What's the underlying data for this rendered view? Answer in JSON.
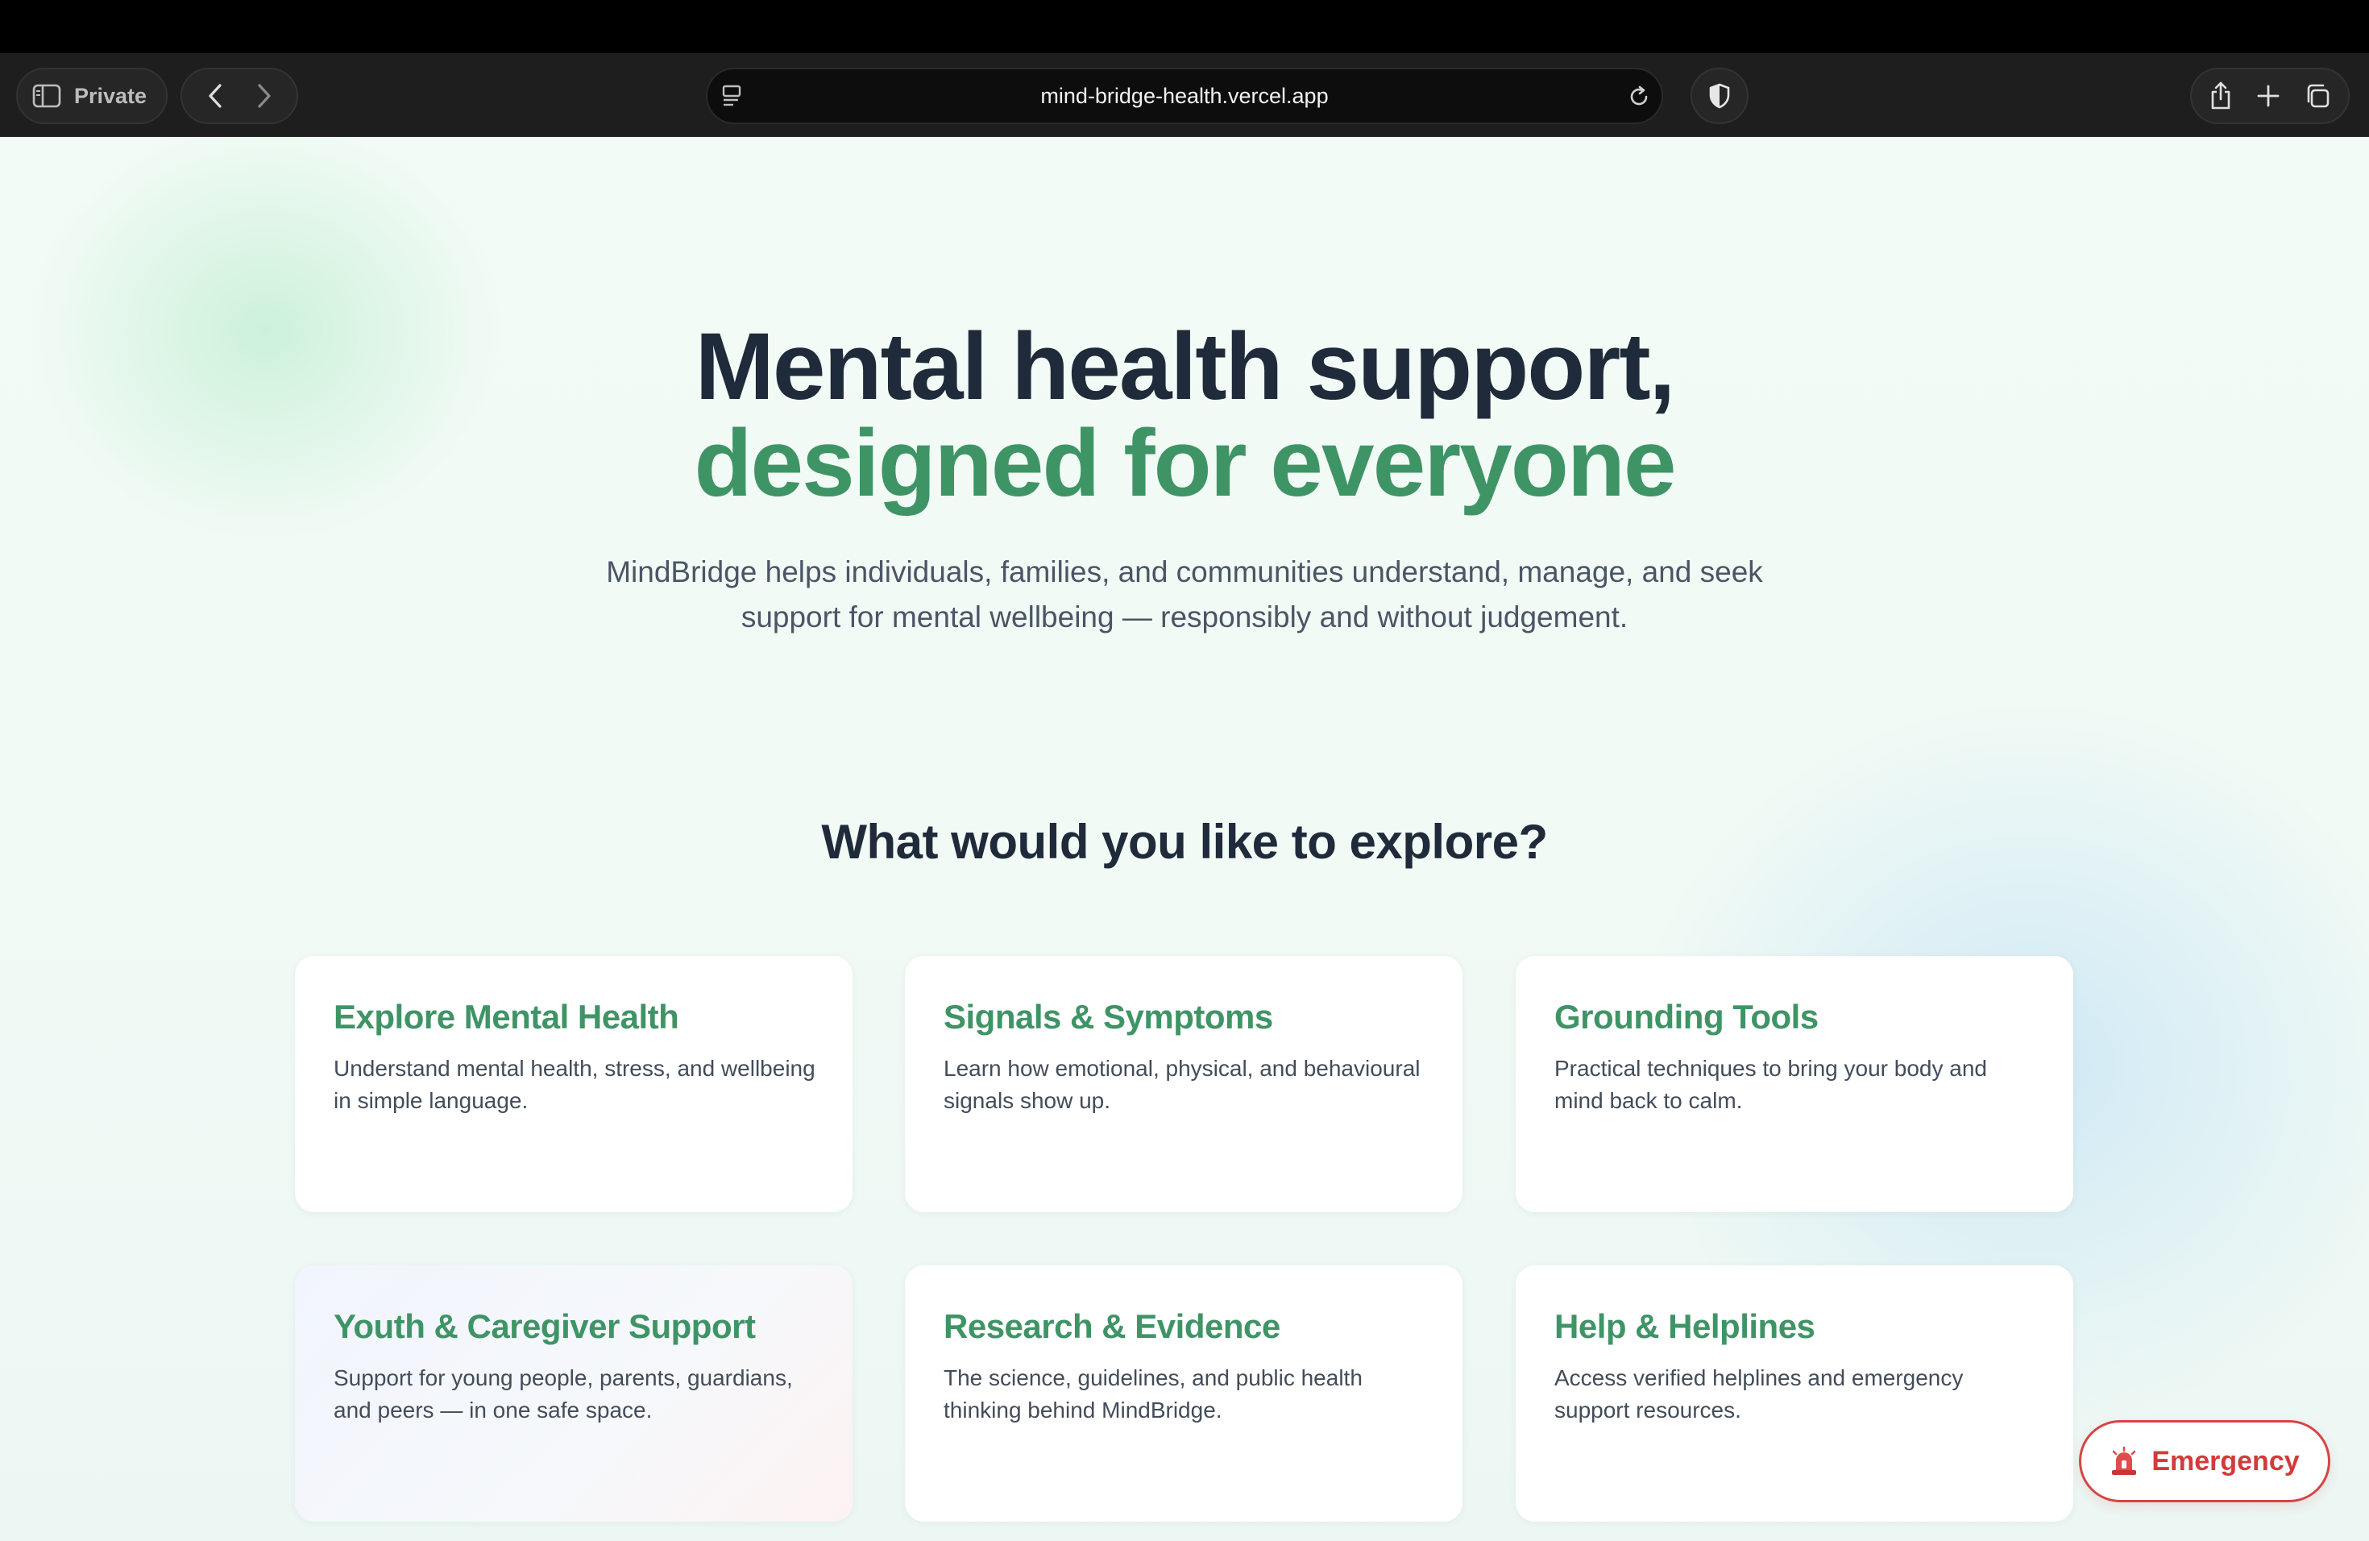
{
  "browser": {
    "private_label": "Private",
    "url": "mind-bridge-health.vercel.app"
  },
  "hero": {
    "line1": "Mental health support,",
    "line2": "designed for everyone",
    "subtitle": "MindBridge helps individuals, families, and communities understand, manage, and seek support for mental wellbeing — responsibly and without judgement."
  },
  "explore": {
    "heading": "What would you like to explore?",
    "cards": [
      {
        "title": "Explore Mental Health",
        "description": "Understand mental health, stress, and wellbeing in simple language."
      },
      {
        "title": "Signals & Symptoms",
        "description": "Learn how emotional, physical, and behavioural signals show up."
      },
      {
        "title": "Grounding Tools",
        "description": "Practical techniques to bring your body and mind back to calm."
      },
      {
        "title": "Youth & Caregiver Support",
        "description": "Support for young people, parents, guardians, and peers — in one safe space."
      },
      {
        "title": "Research & Evidence",
        "description": "The science, guidelines, and public health thinking behind MindBridge."
      },
      {
        "title": "Help & Helplines",
        "description": "Access verified helplines and emergency support resources."
      }
    ]
  },
  "emergency": {
    "label": "Emergency",
    "icon": "siren-icon"
  },
  "colors": {
    "accent_green": "#3f9466",
    "heading_dark": "#1f2a3a",
    "emergency_red": "#d23b3b"
  }
}
